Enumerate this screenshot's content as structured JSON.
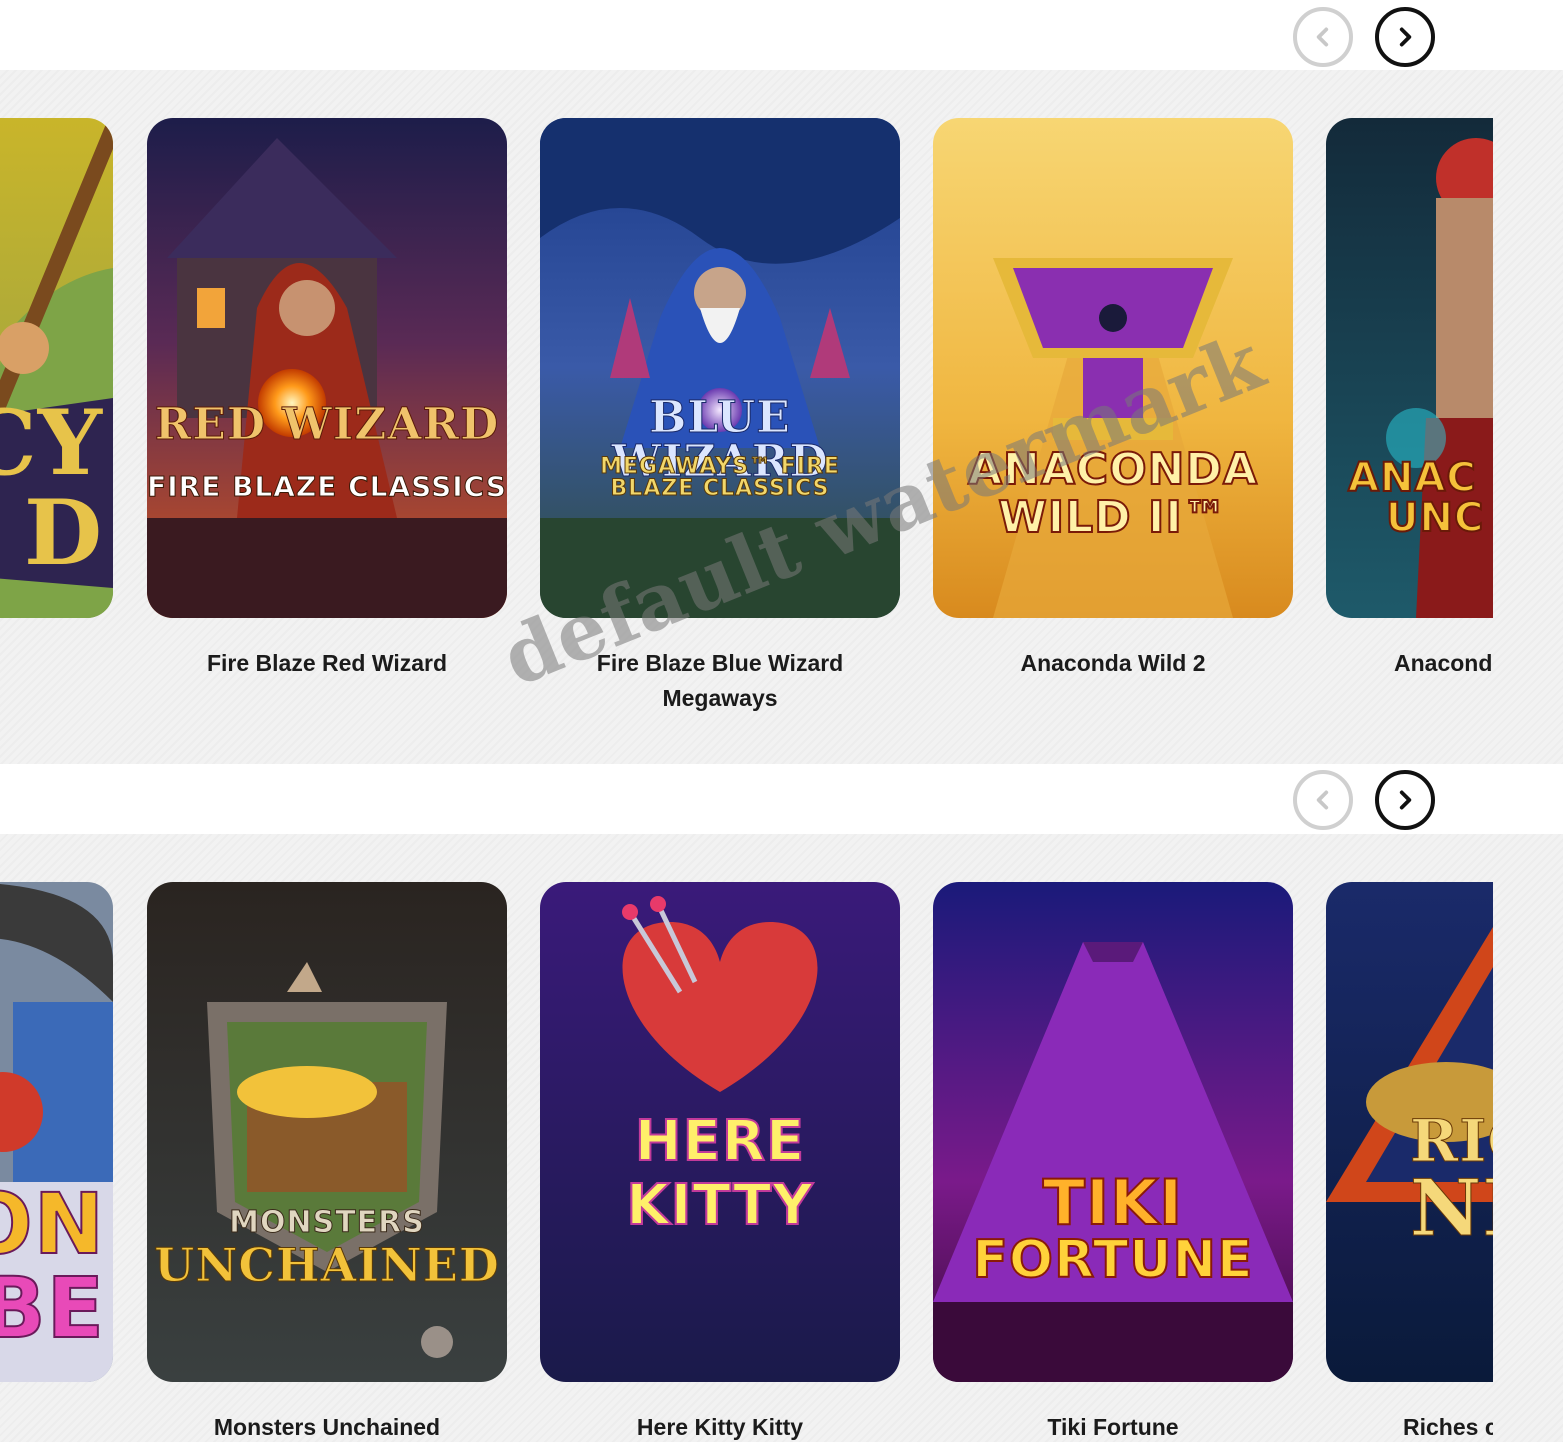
{
  "rows": [
    {
      "cards": [
        {
          "title": "",
          "logo_line1": "CY",
          "logo_line2": "D"
        },
        {
          "title": "Fire Blaze Red Wizard",
          "logo_line1": "RED WIZARD",
          "logo_line2": "FIRE BLAZE CLASSICS"
        },
        {
          "title": "Fire Blaze Blue Wizard Megaways",
          "logo_line1": "BLUE WIZARD",
          "logo_line2": "MEGAWAYS™ FIRE BLAZE CLASSICS"
        },
        {
          "title": "Anaconda Wild 2",
          "logo_line1": "ANACONDA",
          "logo_line2": "WILD II™"
        },
        {
          "title": "Anacond",
          "logo_line1": "ANAC",
          "logo_line2": "UNC"
        }
      ]
    },
    {
      "cards": [
        {
          "title": "e",
          "logo_line1": "ON",
          "logo_line2": "BE"
        },
        {
          "title": "Monsters Unchained",
          "logo_line1": "MONSTERS",
          "logo_line2": "UNCHAINED"
        },
        {
          "title": "Here Kitty Kitty",
          "logo_line1": "HERE KITTY",
          "logo_line2": "KITTY"
        },
        {
          "title": "Tiki Fortune",
          "logo_line1": "TIKI",
          "logo_line2": "FORTUNE"
        },
        {
          "title": "Riches c",
          "logo_line1": "RIC",
          "logo_line2": "NI"
        }
      ]
    }
  ],
  "watermark": "default watermark",
  "icons": {
    "prev": "chevron-left-icon",
    "next": "chevron-right-icon"
  },
  "colors": {
    "header_bg": "#ffffff",
    "page_bg": "#f2f2f2",
    "caption": "#1b1b1b",
    "nav_active": "#111111",
    "nav_disabled": "#d0d0d0"
  }
}
